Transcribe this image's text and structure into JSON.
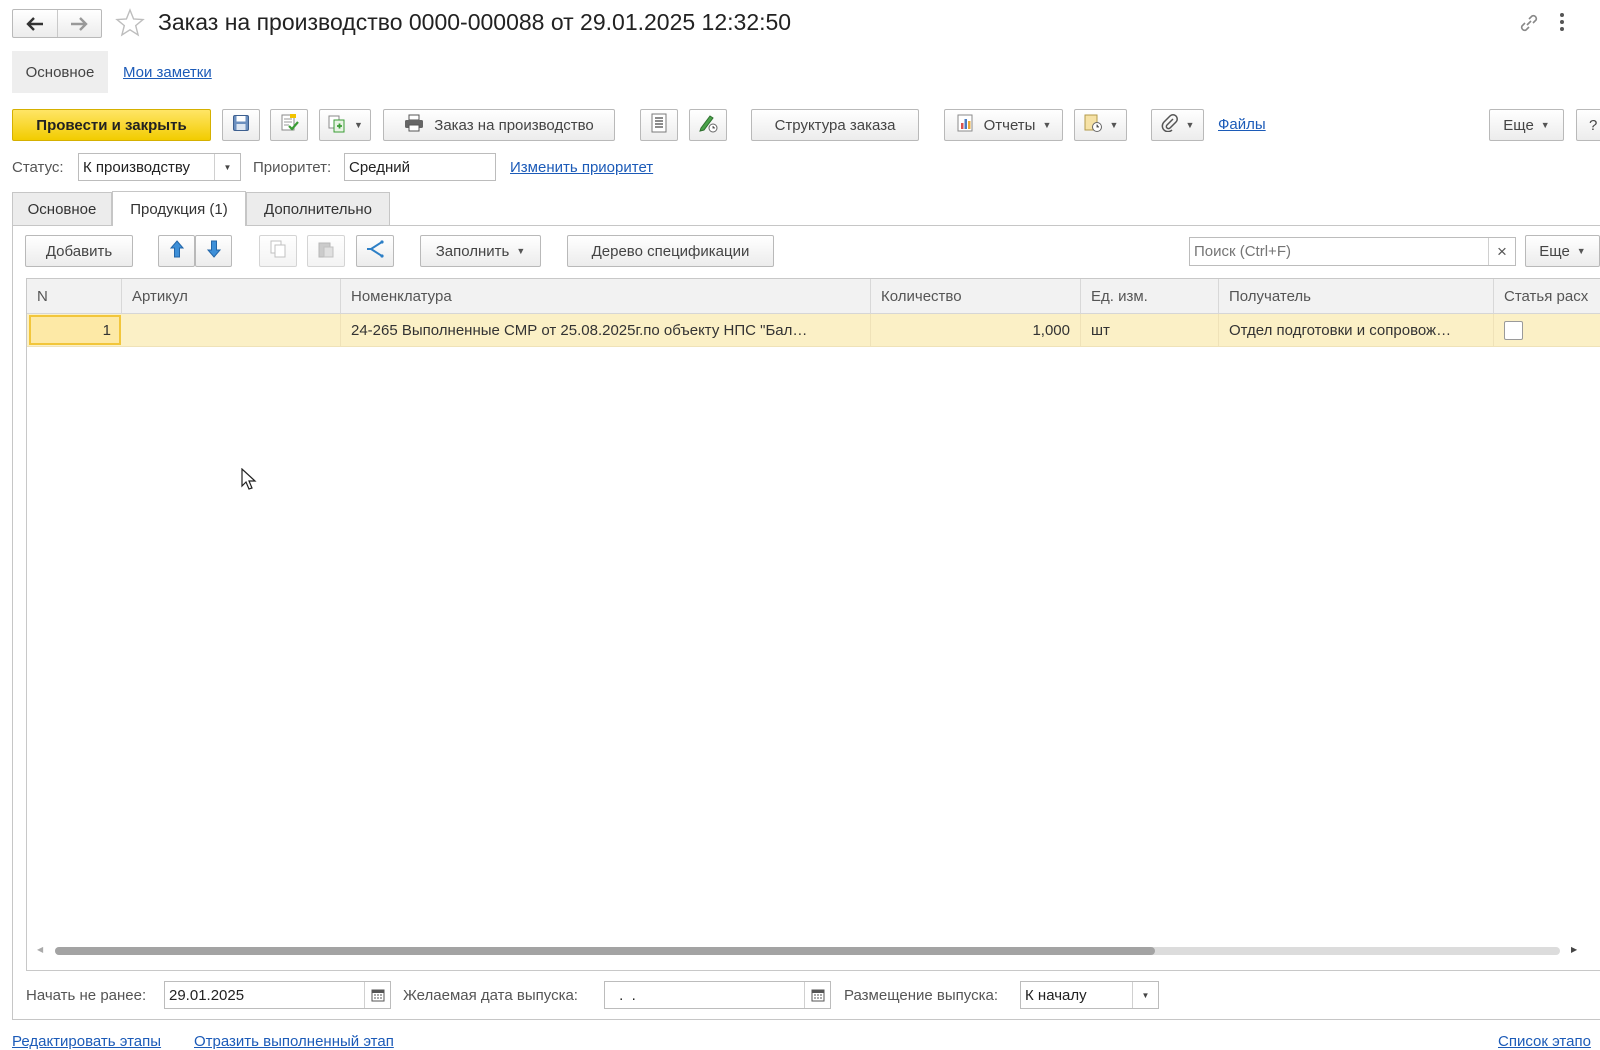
{
  "header": {
    "title": "Заказ на производство 0000-000088 от 29.01.2025 12:32:50"
  },
  "section_nav": {
    "main": "Основное",
    "notes": "Мои заметки"
  },
  "toolbar": {
    "post_close": "Провести и закрыть",
    "print_order": "Заказ на производство",
    "structure": "Структура заказа",
    "reports": "Отчеты",
    "files": "Файлы",
    "more": "Еще",
    "help": "?"
  },
  "status_row": {
    "status_label": "Статус:",
    "status_value": "К производству",
    "priority_label": "Приоритет:",
    "priority_value": "Средний",
    "change_priority": "Изменить приоритет"
  },
  "tabs": [
    {
      "label": "Основное",
      "active": false
    },
    {
      "label": "Продукция (1)",
      "active": true
    },
    {
      "label": "Дополнительно",
      "active": false
    }
  ],
  "table_toolbar": {
    "add": "Добавить",
    "fill": "Заполнить",
    "spec_tree": "Дерево спецификации",
    "search_placeholder": "Поиск (Ctrl+F)",
    "search_clear": "×",
    "more": "Еще"
  },
  "table": {
    "columns": [
      "N",
      "Артикул",
      "Номенклатура",
      "Количество",
      "Ед. изм.",
      "Получатель",
      "Статья расх"
    ],
    "rows": [
      {
        "n": "1",
        "article": "",
        "nomenclature": "24-265 Выполненные СМР от 25.08.2025г.по объекту НПС \"Бал…",
        "quantity": "1,000",
        "unit": "шт",
        "recipient": "Отдел подготовки и сопровож…",
        "expense_checked": false
      }
    ]
  },
  "footer_fields": {
    "start_label": "Начать не ранее:",
    "start_value": "29.01.2025",
    "desired_label": "Желаемая дата выпуска:",
    "desired_value": " .  .",
    "placement_label": "Размещение выпуска:",
    "placement_value": "К началу"
  },
  "bottom_links": {
    "edit_stages": "Редактировать этапы",
    "record_stage": "Отразить выполненный этап",
    "stage_list": "Список этапо"
  },
  "colors": {
    "primary_button": "#f7d51f",
    "selected_row": "#fbf0c6",
    "link": "#1c5bb8"
  }
}
